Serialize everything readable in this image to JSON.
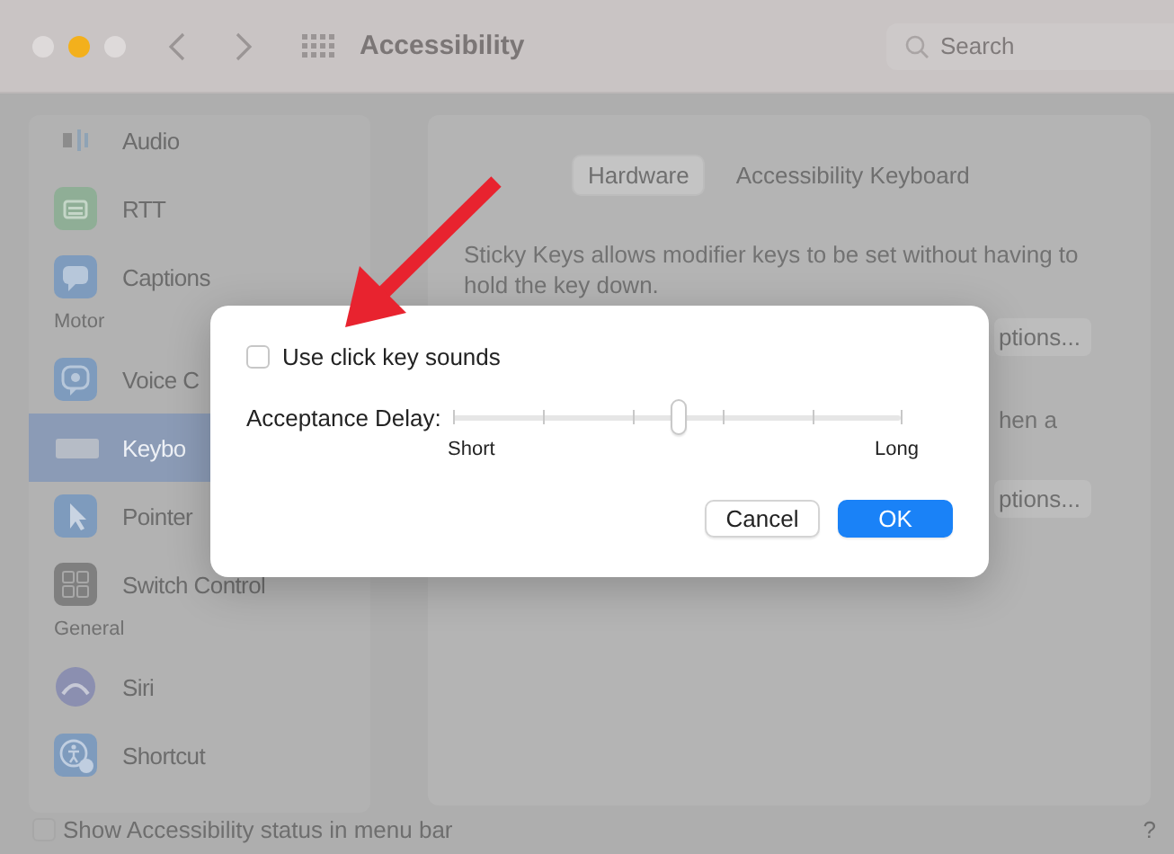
{
  "window": {
    "title": "Accessibility",
    "search": {
      "placeholder": "Search"
    }
  },
  "sidebar": {
    "items": [
      {
        "kind": "item",
        "label": "Audio",
        "selected": false
      },
      {
        "kind": "item",
        "label": "RTT",
        "selected": false
      },
      {
        "kind": "item",
        "label": "Captions",
        "selected": false
      },
      {
        "kind": "header",
        "label": "Motor"
      },
      {
        "kind": "item",
        "label": "Voice C",
        "selected": false
      },
      {
        "kind": "item",
        "label": "Keybo",
        "selected": true
      },
      {
        "kind": "item",
        "label": "Pointer",
        "selected": false
      },
      {
        "kind": "item",
        "label": "Switch Control",
        "selected": false
      },
      {
        "kind": "header",
        "label": "General"
      },
      {
        "kind": "item",
        "label": "Siri",
        "selected": false
      },
      {
        "kind": "item",
        "label": "Shortcut",
        "selected": false
      }
    ]
  },
  "main": {
    "tabs": [
      {
        "label": "Hardware",
        "selected": true
      },
      {
        "label": "Accessibility Keyboard",
        "selected": false
      }
    ],
    "description": "Sticky Keys allows modifier keys to be set without having to hold the key down.",
    "options_buttons": [
      "ptions...",
      "ptions..."
    ],
    "note": "hen a"
  },
  "status_bar": {
    "checkbox": {
      "label": "Show Accessibility status in menu bar",
      "checked": false
    },
    "help": "?"
  },
  "dialog": {
    "checkbox": {
      "label": "Use click key sounds",
      "checked": false
    },
    "slider": {
      "label": "Acceptance Delay:",
      "level": 0.5,
      "min_label": "Short",
      "max_label": "Long"
    },
    "buttons": [
      {
        "label": "Cancel",
        "kind": "secondary"
      },
      {
        "label": "OK",
        "kind": "primary"
      }
    ]
  }
}
